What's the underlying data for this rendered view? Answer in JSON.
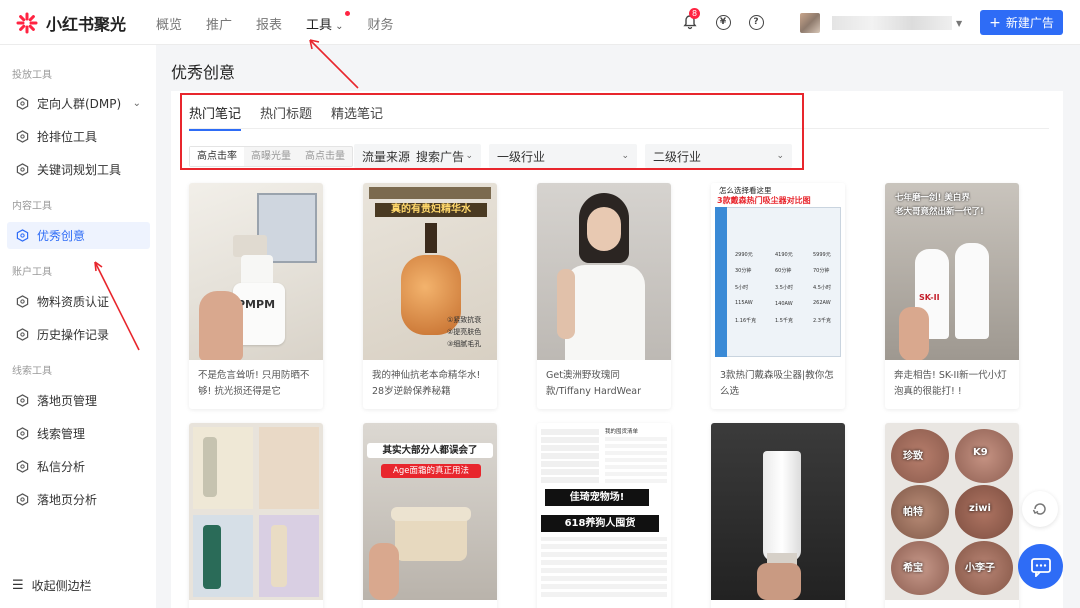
{
  "brand": {
    "name": "小红书聚光"
  },
  "nav": {
    "items": [
      "概览",
      "推广",
      "报表",
      "工具",
      "财务"
    ]
  },
  "top": {
    "notification_count": "8",
    "new_ad_label": "新建广告",
    "plus": "+"
  },
  "sidebar": {
    "sections": [
      "投放工具",
      "内容工具",
      "账户工具",
      "线索工具"
    ],
    "items": [
      "定向人群(DMP)",
      "抢排位工具",
      "关键词规划工具",
      "优秀创意",
      "物料资质认证",
      "历史操作记录",
      "落地页管理",
      "线索管理",
      "私信分析",
      "落地页分析"
    ],
    "collapse_label": "收起侧边栏"
  },
  "page": {
    "title": "优秀创意"
  },
  "tabs": [
    "热门笔记",
    "热门标题",
    "精选笔记"
  ],
  "segments": [
    "高点击率",
    "高曝光量",
    "高点击量"
  ],
  "filters": {
    "traffic_label": "流量来源",
    "traffic_value": "搜索广告",
    "industry1": "一级行业",
    "industry2": "二级行业"
  },
  "cards": [
    {
      "title": "不是危言耸听! 只用防晒不够! 抗光损还得是它",
      "overlay": [
        "PMPM"
      ]
    },
    {
      "title": "我的神仙抗老本命精华水! 28岁逆龄保养秘籍",
      "overlay": [
        "真的有贵妇精华水",
        "①紧致抗衰",
        "②提亮肤色",
        "③细腻毛孔"
      ]
    },
    {
      "title": "Get澳洲野玫瑰同款/Tiffany HardWear",
      "overlay": []
    },
    {
      "title": "3款热门戴森吸尘器|教你怎么选",
      "overlay": [
        "怎么选择看这里",
        "3款戴森热门吸尘器对比图",
        "2990元",
        "4190元",
        "5999元",
        "30分钟",
        "60分钟",
        "70分钟",
        "5小时",
        "3.5小时",
        "4.5小时",
        "115AW",
        "140AW",
        "262AW",
        "1.16千克",
        "1.5千克",
        "2.3千克"
      ]
    },
    {
      "title": "奔走相告! SK-II新一代小灯泡真的很能打! !",
      "overlay": [
        "七年磨一剑! 美白界",
        "老大哥竟然出新一代了!",
        "SK-II"
      ]
    },
    {
      "title": "",
      "overlay": []
    },
    {
      "title": "",
      "overlay": [
        "其实大部分人都误会了",
        "Age面霜的真正用法"
      ]
    },
    {
      "title": "",
      "overlay": [
        "我的囤货清单",
        "佳琦宠物场!",
        "618养狗人囤货"
      ]
    },
    {
      "title": "",
      "overlay": []
    },
    {
      "title": "",
      "overlay": [
        "珍致",
        "K9",
        "帕特",
        "ziwi",
        "希宝",
        "小李子"
      ]
    }
  ],
  "colors": {
    "accent": "#2e6cf6",
    "brand_red": "#ff2442",
    "annotation_red": "#e8262d"
  }
}
